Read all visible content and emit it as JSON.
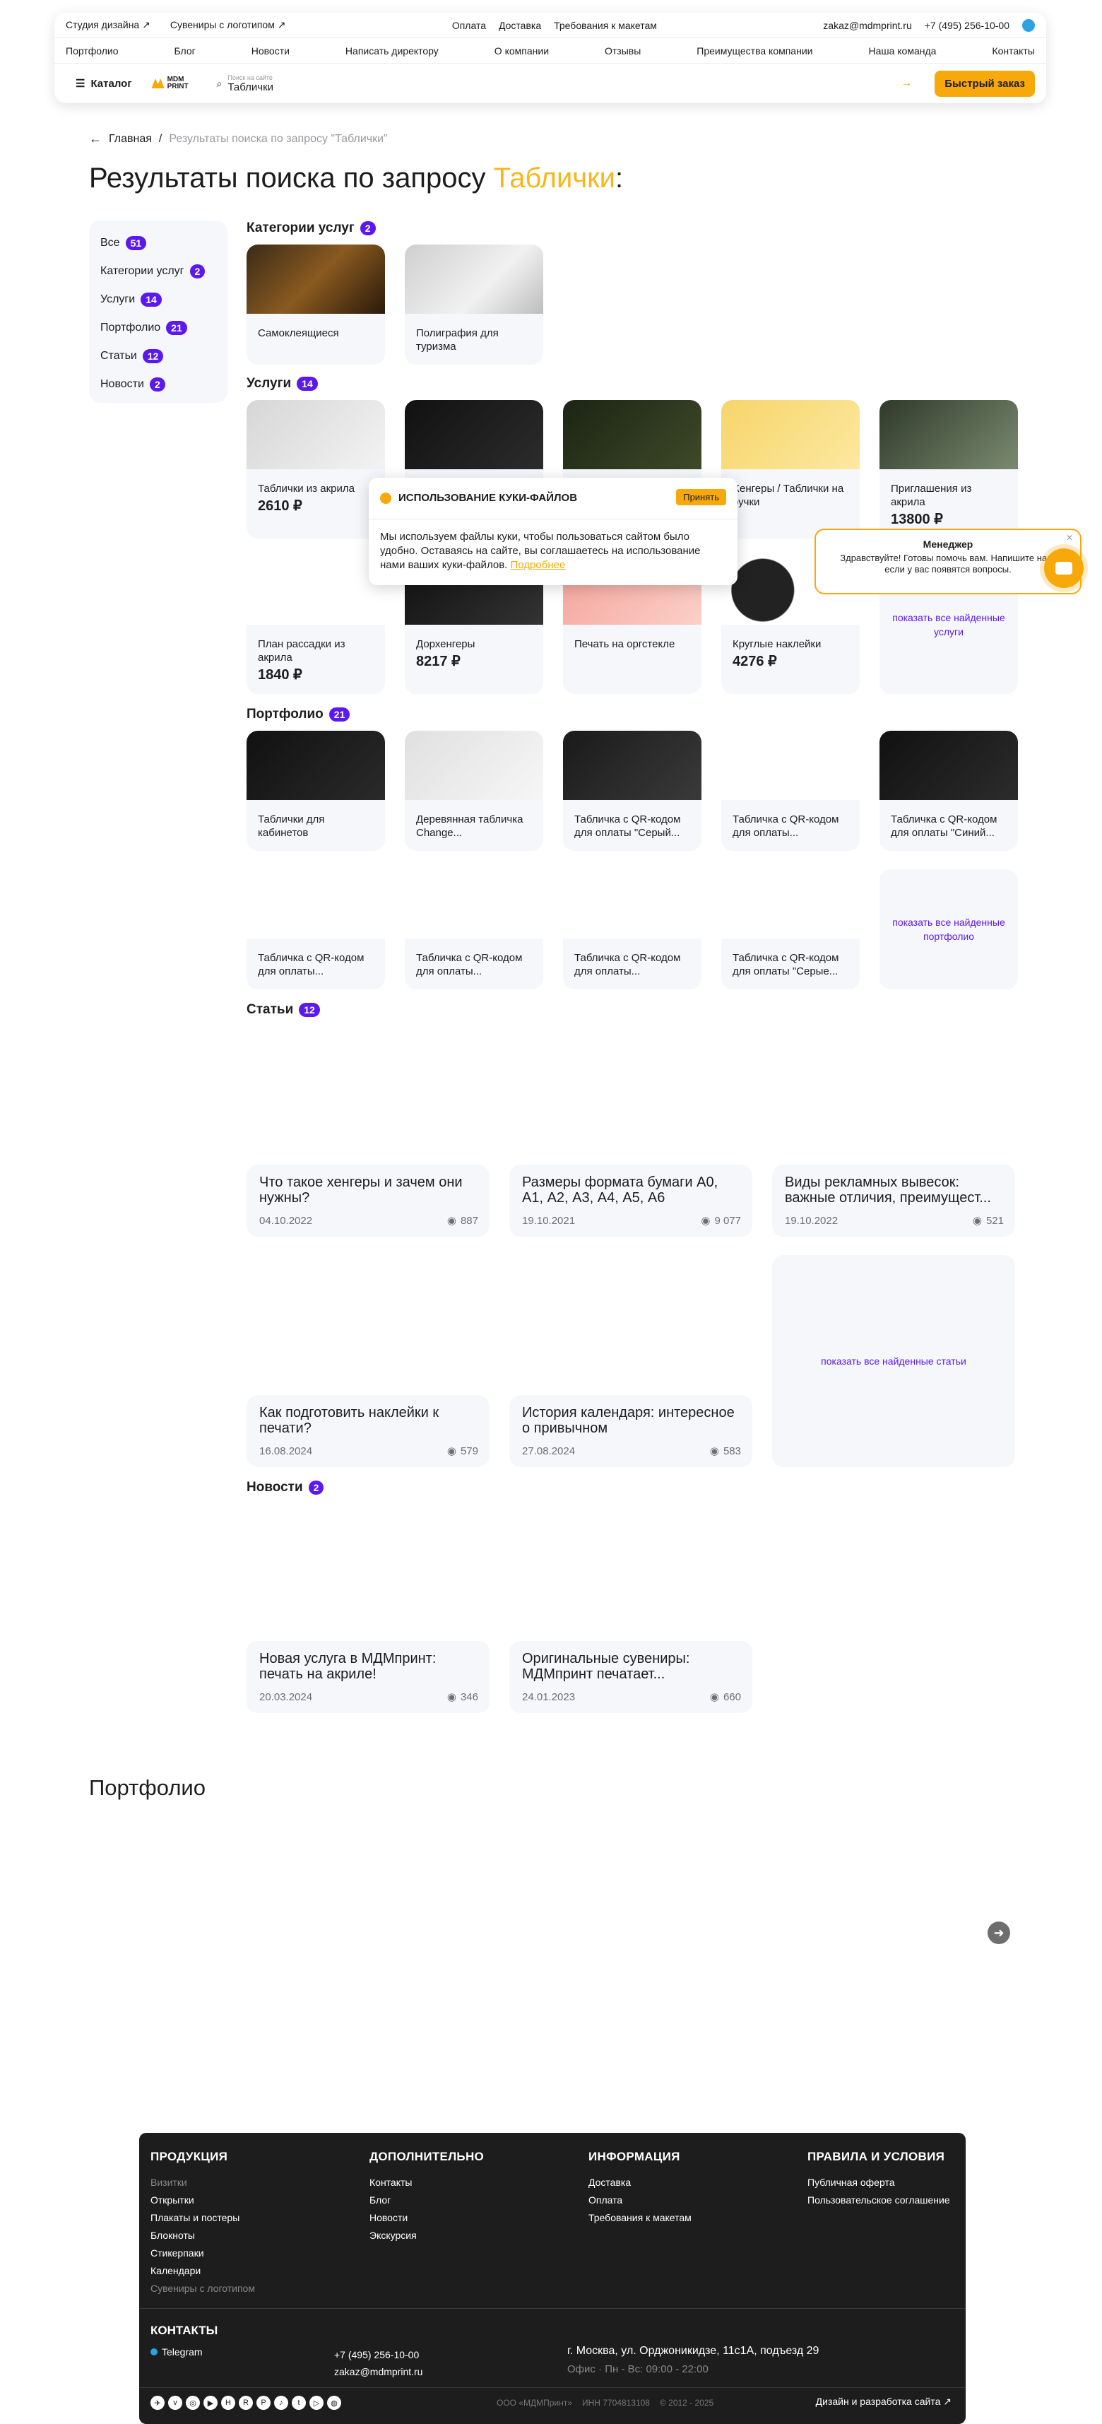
{
  "header": {
    "top_left": [
      "Студия дизайна",
      "Сувениры с логотипом"
    ],
    "top_center": [
      "Оплата",
      "Доставка",
      "Требования к макетам"
    ],
    "email": "zakaz@mdmprint.ru",
    "phone": "+7 (495) 256-10-00",
    "nav": [
      "Портфолио",
      "Блог",
      "Новости",
      "Написать директору",
      "О компании",
      "Отзывы",
      "Преимущества компании",
      "Наша команда",
      "Контакты"
    ],
    "catalog_label": "Каталог",
    "logo_text": [
      "MDM",
      "PRINT"
    ],
    "search_hint": "Поиск на сайте",
    "search_value": "Таблички",
    "quick_order": "Быстрый заказ"
  },
  "breadcrumb": {
    "home": "Главная",
    "current": "Результаты поиска по запросу \"Таблички\""
  },
  "page_title": {
    "prefix": "Результаты поиска по запросу",
    "query": "Таблички",
    "suffix": ":"
  },
  "filters": [
    {
      "label": "Все",
      "count": "51"
    },
    {
      "label": "Категории услуг",
      "count": "2"
    },
    {
      "label": "Услуги",
      "count": "14"
    },
    {
      "label": "Портфолио",
      "count": "21"
    },
    {
      "label": "Статьи",
      "count": "12"
    },
    {
      "label": "Новости",
      "count": "2"
    }
  ],
  "categories": {
    "title": "Категории услуг",
    "count": "2",
    "items": [
      "Самоклеящиеся",
      "Полиграфия для туризма"
    ]
  },
  "services": {
    "title": "Услуги",
    "count": "14",
    "items": [
      {
        "title": "Таблички из акрила",
        "price": "2610 ₽"
      },
      {
        "title": "",
        "price": ""
      },
      {
        "title": "",
        "price": ""
      },
      {
        "title": "Хенгеры / Таблички на ручки",
        "price": ""
      },
      {
        "title": "Приглашения из акрила",
        "price": "13800 ₽"
      },
      {
        "title": "План рассадки из акрила",
        "price": "1840 ₽"
      },
      {
        "title": "Дорхенгеры",
        "price": "8217 ₽"
      },
      {
        "title": "Печать на оргстекле",
        "price": ""
      },
      {
        "title": "Круглые наклейки",
        "price": "4276 ₽"
      }
    ],
    "more": "показать все найденные услуги"
  },
  "portfolio": {
    "title": "Портфолио",
    "count": "21",
    "items": [
      "Таблички для кабинетов",
      "Деревянная табличка Change...",
      "Табличка с QR-кодом для оплаты \"Серый...",
      "Табличка с QR-кодом для оплаты...",
      "Табличка с QR-кодом для оплаты \"Синий...",
      "Табличка с QR-кодом для оплаты...",
      "Табличка с QR-кодом для оплаты...",
      "Табличка с QR-кодом для оплаты...",
      "Табличка с QR-кодом для оплаты \"Серые..."
    ],
    "more": "показать все найденные портфолио"
  },
  "articles": {
    "title": "Статьи",
    "count": "12",
    "items": [
      {
        "title": "Что такое хенгеры и зачем они нужны?",
        "date": "04.10.2022",
        "views": "887"
      },
      {
        "title": "Размеры формата бумаги А0, А1, А2, А3, А4, А5, А6",
        "date": "19.10.2021",
        "views": "9 077"
      },
      {
        "title": "Виды рекламных вывесок: важные отличия, преимущест...",
        "date": "19.10.2022",
        "views": "521"
      },
      {
        "title": "Как подготовить наклейки к печати?",
        "date": "16.08.2024",
        "views": "579"
      },
      {
        "title": "История календаря: интересное о привычном",
        "date": "27.08.2024",
        "views": "583"
      }
    ],
    "more": "показать все найденные статьи"
  },
  "news": {
    "title": "Новости",
    "count": "2",
    "items": [
      {
        "title": "Новая услуга в МДМпринт: печать на акриле!",
        "date": "20.03.2024",
        "views": "346"
      },
      {
        "title": "Оригинальные сувениры: МДМпринт печатает...",
        "date": "24.01.2023",
        "views": "660"
      }
    ]
  },
  "portfolio_section_title": "Портфолио",
  "cookie": {
    "title": "ИСПОЛЬЗОВАНИЕ КУКИ-ФАЙЛОВ",
    "accept": "Принять",
    "text": "Мы используем файлы куки, чтобы пользоваться сайтом было удобно. Оставаясь на сайте, вы соглашаетесь на использование нами ваших куки-файлов.",
    "link": "Подробнее"
  },
  "manager": {
    "title": "Менеджер",
    "text": "Здравствуйте! Готовы помочь вам. Напишите нам, если у вас появятся вопросы."
  },
  "footer": {
    "cols": [
      {
        "title": "ПРОДУКЦИЯ",
        "items": [
          "Визитки",
          "Открытки",
          "Плакаты и постеры",
          "Блокноты",
          "Стикерпаки",
          "Календари",
          "Сувениры с логотипом"
        ]
      },
      {
        "title": "ДОПОЛНИТЕЛЬНО",
        "items": [
          "Контакты",
          "Блог",
          "Новости",
          "Экскурсия"
        ]
      },
      {
        "title": "ИНФОРМАЦИЯ",
        "items": [
          "Доставка",
          "Оплата",
          "Требования к макетам"
        ]
      },
      {
        "title": "ПРАВИЛА И УСЛОВИЯ",
        "items": [
          "Публичная оферта",
          "Пользовательское соглашение"
        ]
      }
    ],
    "contacts_title": "КОНТАКТЫ",
    "telegram": "Telegram",
    "phone": "+7 (495) 256-10-00",
    "email": "zakaz@mdmprint.ru",
    "address": "г. Москва, ул. Орджоникидзе, 11с1А, подъезд 29",
    "hours": "Офис · Пн - Вс: 09:00 - 22:00",
    "company": "ООО «МДМПринт»",
    "inn": "ИНН 7704813108",
    "years": "© 2012 - 2025",
    "dev": "Дизайн и разработка сайта"
  }
}
